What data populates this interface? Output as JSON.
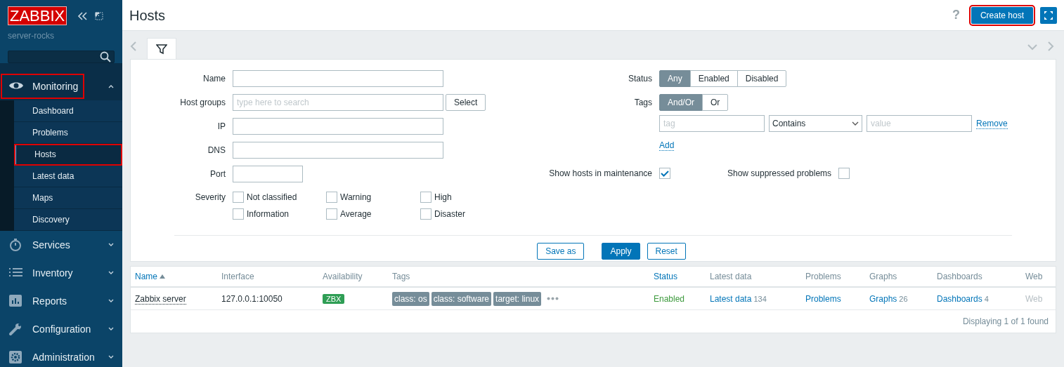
{
  "sidebar": {
    "logo": "ZABBIX",
    "server_name": "server-rocks",
    "menu": [
      {
        "label": "Monitoring",
        "expanded": true,
        "highlighted": true,
        "children": [
          {
            "label": "Dashboard",
            "selected": false,
            "highlighted": false
          },
          {
            "label": "Problems",
            "selected": false,
            "highlighted": false
          },
          {
            "label": "Hosts",
            "selected": true,
            "highlighted": true
          },
          {
            "label": "Latest data",
            "selected": false,
            "highlighted": false
          },
          {
            "label": "Maps",
            "selected": false,
            "highlighted": false
          },
          {
            "label": "Discovery",
            "selected": false,
            "highlighted": false
          }
        ]
      },
      {
        "label": "Services",
        "expanded": false,
        "highlighted": false
      },
      {
        "label": "Inventory",
        "expanded": false,
        "highlighted": false
      },
      {
        "label": "Reports",
        "expanded": false,
        "highlighted": false
      },
      {
        "label": "Configuration",
        "expanded": false,
        "highlighted": false
      },
      {
        "label": "Administration",
        "expanded": false,
        "highlighted": false
      }
    ]
  },
  "header": {
    "title": "Hosts",
    "help": "?",
    "create_button": {
      "label": "Create host",
      "highlighted": true
    }
  },
  "filter": {
    "tab": {
      "selected": true
    },
    "left_fields": [
      {
        "kind": "text",
        "label": "Name"
      },
      {
        "kind": "multiselect",
        "label": "Host groups",
        "placeholder": "type here to search",
        "button": "Select"
      },
      {
        "kind": "text",
        "label": "IP"
      },
      {
        "kind": "text",
        "label": "DNS"
      },
      {
        "kind": "short",
        "label": "Port"
      },
      {
        "kind": "checkboxes",
        "label": "Severity",
        "options": [
          {
            "label": "Not classified",
            "checked": false
          },
          {
            "label": "Warning",
            "checked": false
          },
          {
            "label": "High",
            "checked": false
          },
          {
            "label": "Information",
            "checked": false
          },
          {
            "label": "Average",
            "checked": false
          },
          {
            "label": "Disaster",
            "checked": false
          }
        ]
      }
    ],
    "status": {
      "label": "Status",
      "options": [
        {
          "label": "Any",
          "selected": true
        },
        {
          "label": "Enabled",
          "selected": false
        },
        {
          "label": "Disabled",
          "selected": false
        }
      ]
    },
    "tags": {
      "label": "Tags",
      "options": [
        {
          "label": "And/Or",
          "selected": true
        },
        {
          "label": "Or",
          "selected": false
        }
      ],
      "row": {
        "tag_placeholder": "tag",
        "operator": "Contains",
        "value_placeholder": "value",
        "remove": "Remove"
      },
      "add": "Add"
    },
    "options": [
      {
        "label": "Show hosts in maintenance",
        "checked": true
      },
      {
        "label": "Show suppressed problems",
        "checked": false
      }
    ],
    "buttons": [
      {
        "label": "Save as",
        "primary": false
      },
      {
        "label": "Apply",
        "primary": true
      },
      {
        "label": "Reset",
        "primary": false
      }
    ]
  },
  "table": {
    "columns": [
      {
        "label": "Name",
        "sortable": true,
        "sorted": true
      },
      {
        "label": "Interface",
        "sortable": false,
        "sorted": false
      },
      {
        "label": "Availability",
        "sortable": false,
        "sorted": false
      },
      {
        "label": "Tags",
        "sortable": false,
        "sorted": false
      },
      {
        "label": "Status",
        "sortable": true,
        "sorted": false
      },
      {
        "label": "Latest data",
        "sortable": false,
        "sorted": false
      },
      {
        "label": "Problems",
        "sortable": false,
        "sorted": false
      },
      {
        "label": "Graphs",
        "sortable": false,
        "sorted": false
      },
      {
        "label": "Dashboards",
        "sortable": false,
        "sorted": false
      },
      {
        "label": "Web",
        "sortable": false,
        "sorted": false
      }
    ],
    "rows": [
      {
        "name": "Zabbix server",
        "interface": "127.0.0.1:10050",
        "availability": {
          "label": "ZBX",
          "color": "#2f9e55"
        },
        "tags": [
          "class: os",
          "class: software",
          "target: linux"
        ],
        "more_tags": true,
        "status": {
          "label": "Enabled",
          "enabled": true
        },
        "latest_data": {
          "label": "Latest data",
          "count": "134"
        },
        "problems": {
          "label": "Problems"
        },
        "graphs": {
          "label": "Graphs",
          "count": "26"
        },
        "dashboards": {
          "label": "Dashboards",
          "count": "4"
        },
        "web": {
          "label": "Web",
          "disabled": true
        }
      }
    ],
    "footer": "Displaying 1 of 1 found"
  }
}
